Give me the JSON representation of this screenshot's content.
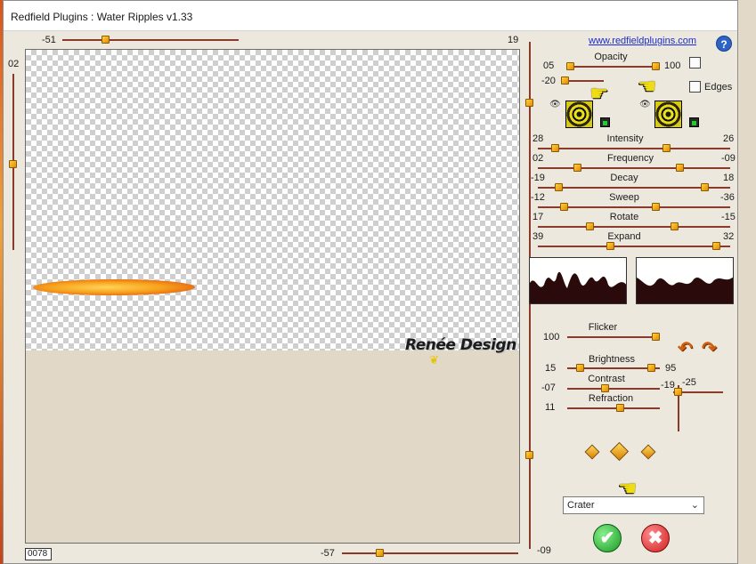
{
  "window": {
    "title": "Redfield Plugins : Water Ripples v1.33"
  },
  "website": "www.redfieldplugins.com",
  "help": "?",
  "top_slider": {
    "min_label": "-51",
    "max_label": "19"
  },
  "left_slider": {
    "label": "02"
  },
  "bottom_slider": {
    "label": "-57"
  },
  "right_slider": {
    "label": "-09"
  },
  "frame_counter": "0078",
  "watermark": "Renée Design",
  "opacity": {
    "label": "Opacity",
    "left_value": "05",
    "right_value": "100",
    "second_value": "-20"
  },
  "edges": {
    "label": "Edges"
  },
  "params": [
    {
      "label": "Intensity",
      "left": "28",
      "right": "26"
    },
    {
      "label": "Frequency",
      "left": "02",
      "right": "-09"
    },
    {
      "label": "Decay",
      "left": "-19",
      "right": "18"
    },
    {
      "label": "Sweep",
      "left": "-12",
      "right": "-36"
    },
    {
      "label": "Rotate",
      "left": "17",
      "right": "-15"
    },
    {
      "label": "Expand",
      "left": "39",
      "right": "32"
    }
  ],
  "flicker": {
    "label": "Flicker",
    "value": "100"
  },
  "brightness": {
    "label": "Brightness",
    "left": "15",
    "right": "95"
  },
  "contrast": {
    "label": "Contrast",
    "left": "-07",
    "right": "-19"
  },
  "refraction": {
    "label": "Refraction",
    "value": "11"
  },
  "vertical_right": {
    "value": "-25"
  },
  "preset": {
    "selected": "Crater"
  },
  "buttons": {
    "ok": "✔",
    "cancel": "✖"
  },
  "colors": {
    "track": "#8a3a2a",
    "thumb": "#f0a010",
    "link": "#1a2bd0"
  },
  "icons": [
    "eye-icon",
    "pointing-hand-icon",
    "undo-arrow-icon",
    "redo-arrow-icon",
    "diamond-icon",
    "help-icon"
  ]
}
